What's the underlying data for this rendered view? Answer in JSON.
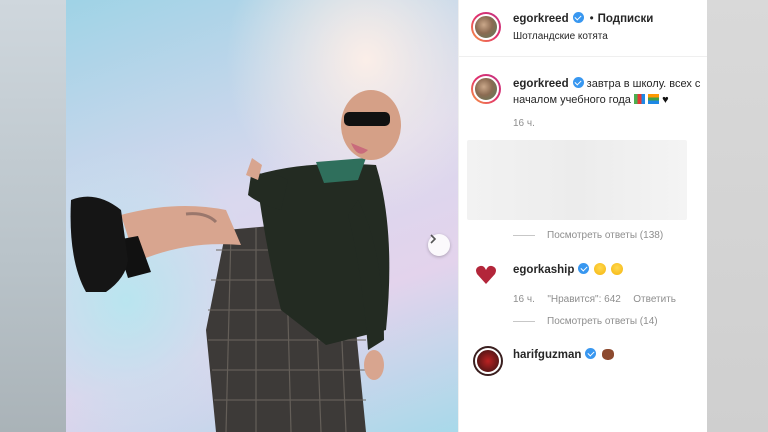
{
  "post": {
    "username": "egorkreed",
    "separator": "•",
    "follow_label": "Подписки",
    "location": "Шотландские котята",
    "caption_username": "egorkreed",
    "caption_text": "завтра в школу. всех с началом учебного года",
    "caption_time": "16 ч.",
    "caption_emojis": [
      "books-emoji",
      "books-emoji",
      "black-heart-emoji"
    ]
  },
  "comments": [
    {
      "view_replies": "Посмотреть ответы (138)"
    },
    {
      "username": "egorkaship",
      "emojis": [
        "grinning-face-emoji",
        "laughing-face-emoji"
      ],
      "time": "16 ч.",
      "likes": "\"Нравится\": 642",
      "reply_label": "Ответить",
      "view_replies": "Посмотреть ответы (14)"
    },
    {
      "username": "harifguzman",
      "emojis": [
        "bear-emoji"
      ]
    }
  ],
  "colors": {
    "verified": "#3897f0",
    "text": "#262626",
    "muted": "#8e8e8e"
  }
}
